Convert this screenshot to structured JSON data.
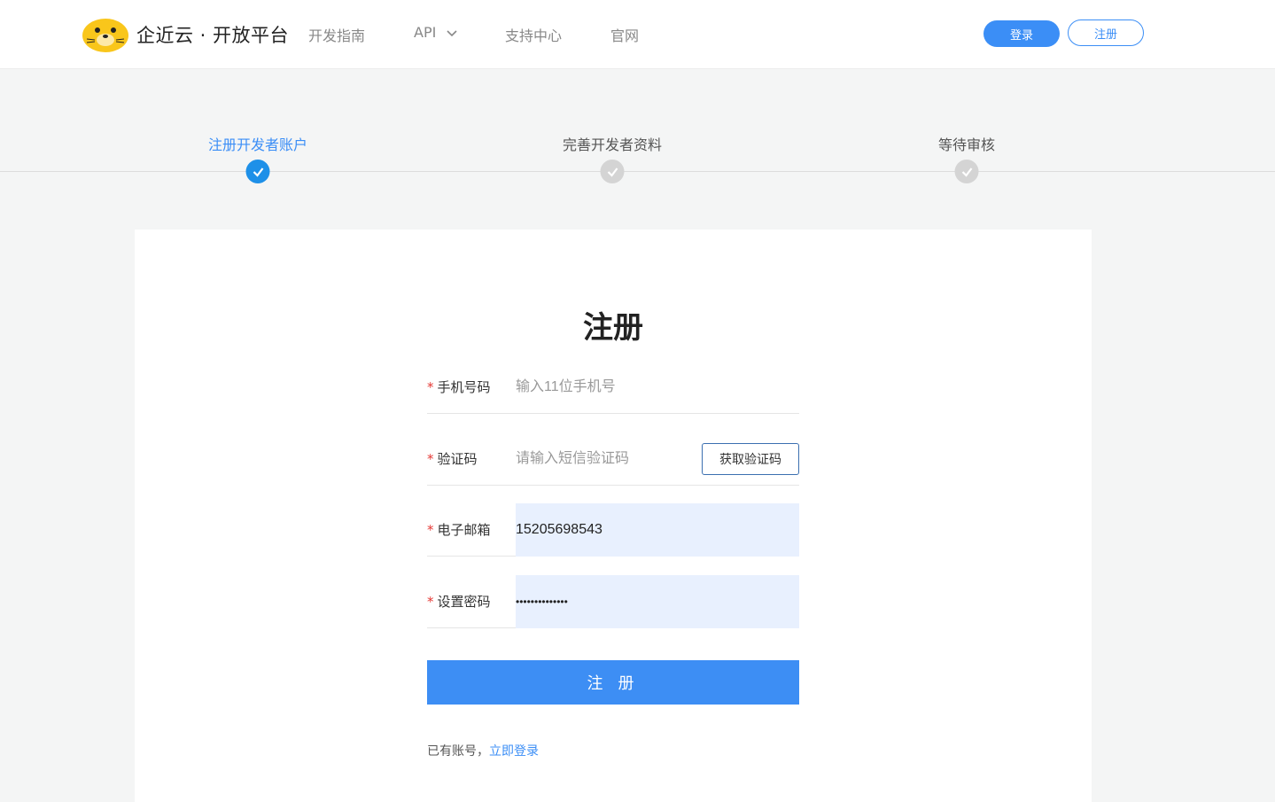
{
  "header": {
    "brand": "企近云 · 开放平台",
    "nav": [
      {
        "label": "开发指南"
      },
      {
        "label": "API"
      },
      {
        "label": "支持中心"
      },
      {
        "label": "官网"
      }
    ],
    "login_label": "登录",
    "register_label": "注册"
  },
  "steps": [
    {
      "label": "注册开发者账户",
      "state": "done"
    },
    {
      "label": "完善开发者资料",
      "state": "pending"
    },
    {
      "label": "等待审核",
      "state": "pending"
    }
  ],
  "form": {
    "title": "注册",
    "required_mark": "*",
    "phone": {
      "label": "手机号码",
      "placeholder": "输入11位手机号",
      "value": ""
    },
    "code": {
      "label": "验证码",
      "placeholder": "请输入短信验证码",
      "value": "",
      "button": "获取验证码"
    },
    "email": {
      "label": "电子邮箱",
      "value": "15205698543"
    },
    "password": {
      "label": "设置密码",
      "value": "••••••••••••••"
    },
    "submit_label": "注 册",
    "footer_text": "已有账号，",
    "footer_link": "立即登录"
  },
  "colors": {
    "accent": "#3b8ef6",
    "step_active": "#1e90e8",
    "step_inactive": "#d4d4d4",
    "required": "#e53935",
    "autofill_bg": "#e8f0fe"
  }
}
